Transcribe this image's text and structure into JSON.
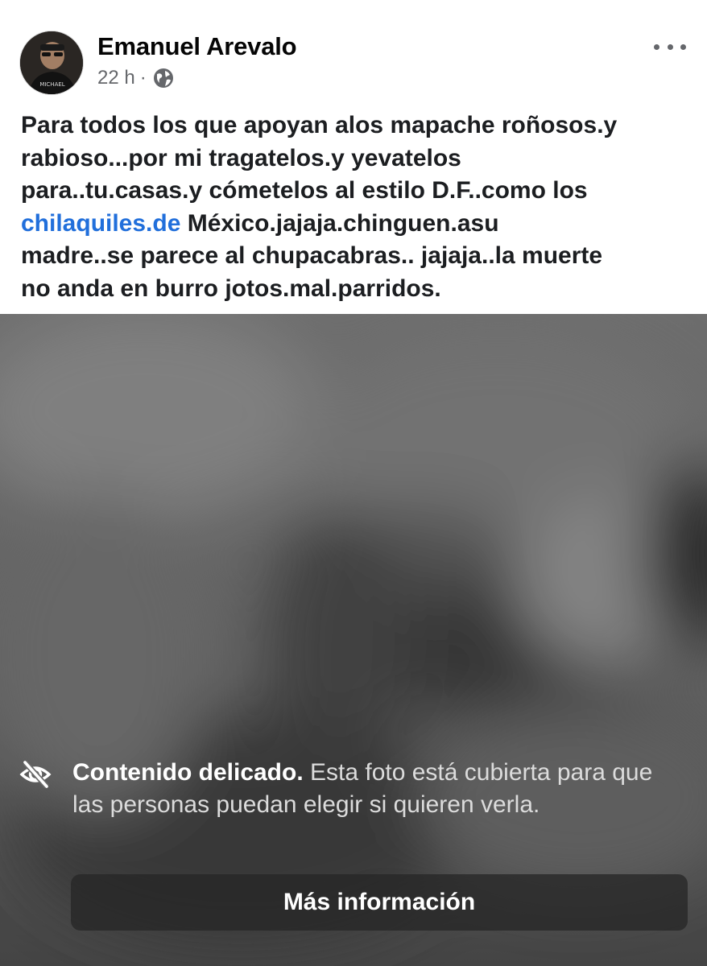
{
  "post": {
    "author": "Emanuel Arevalo",
    "time": "22 h",
    "separator": "·",
    "privacy_icon": "globe-icon",
    "more_icon": "more-horizontal-icon"
  },
  "body": {
    "line1": "Para todos los que apoyan alos mapache roñosos.y",
    "line2": "rabioso...por mi tragatelos.y yevatelos",
    "line3": "para..tu.casas.y cómetelos al estilo D.F..como los",
    "link": "chilaquiles.de",
    "line4_rest": " México.jajaja.chinguen.asu",
    "line5": "madre..se parece al chupacabras.. jajaja..la muerte",
    "line6": "no anda en burro jotos.mal.parridos."
  },
  "sensitive": {
    "icon": "eye-off-icon",
    "title": "Contenido delicado.",
    "message": " Esta foto está cubierta para que las personas puedan elegir si quieren verla.",
    "button_label": "Más información"
  },
  "colors": {
    "link": "#216fdb",
    "text": "#1c1e21",
    "meta": "#65676b"
  }
}
